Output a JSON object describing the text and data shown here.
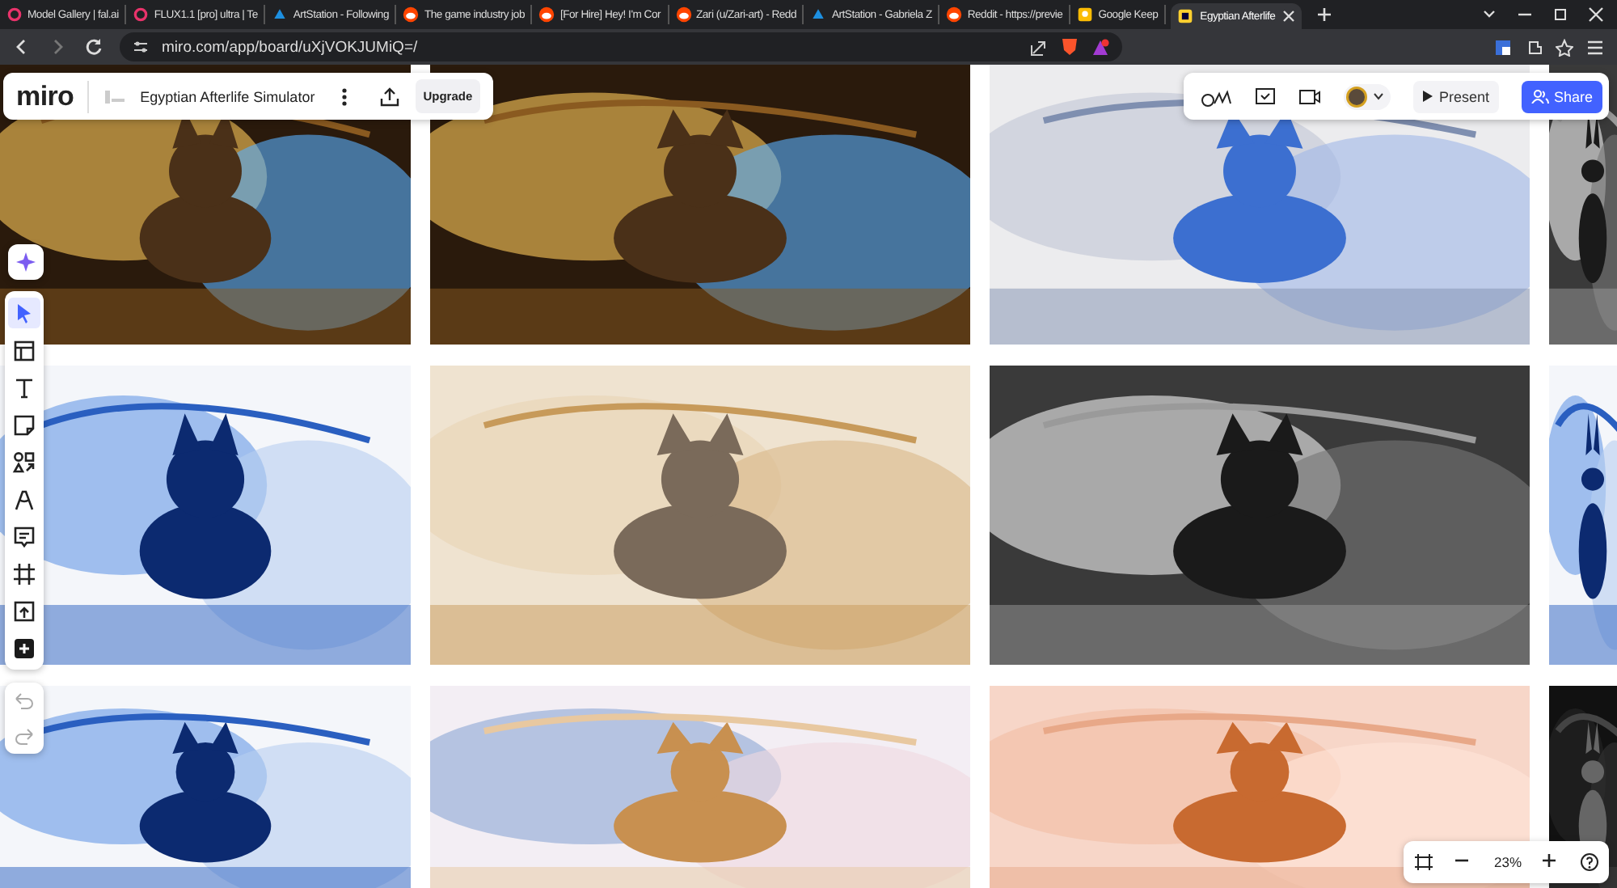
{
  "browser": {
    "tabs": [
      {
        "label": "Model Gallery | fal.ai",
        "selected": false
      },
      {
        "label": "FLUX1.1 [pro] ultra | Te",
        "selected": false
      },
      {
        "label": "ArtStation - Following",
        "selected": false
      },
      {
        "label": "The game industry job",
        "selected": false
      },
      {
        "label": "[For Hire] Hey! I'm Cor",
        "selected": false
      },
      {
        "label": "Zari (u/Zari-art) - Redd",
        "selected": false
      },
      {
        "label": "ArtStation - Gabriela Z",
        "selected": false
      },
      {
        "label": "Reddit - https://previe",
        "selected": false
      },
      {
        "label": "Google Keep",
        "selected": false
      },
      {
        "label": "Egyptian Afterlife",
        "selected": true
      }
    ],
    "address": "miro.com/app/board/uXjVOKJUMiQ=/"
  },
  "board": {
    "logo": "miro",
    "title": "Egyptian Afterlife Simulator",
    "upgrade": "Upgrade",
    "present": "Present",
    "share": "Share",
    "zoom": "23%",
    "tools": [
      {
        "kind": "ai",
        "selected": false
      },
      {
        "kind": "select",
        "selected": true
      },
      {
        "kind": "templates",
        "selected": false
      },
      {
        "kind": "text",
        "selected": false
      },
      {
        "kind": "sticky",
        "selected": false
      },
      {
        "kind": "shapes",
        "selected": false
      },
      {
        "kind": "pen",
        "selected": false
      },
      {
        "kind": "comment",
        "selected": false
      },
      {
        "kind": "frame",
        "selected": false
      },
      {
        "kind": "upload",
        "selected": false
      },
      {
        "kind": "more",
        "selected": false
      }
    ]
  }
}
